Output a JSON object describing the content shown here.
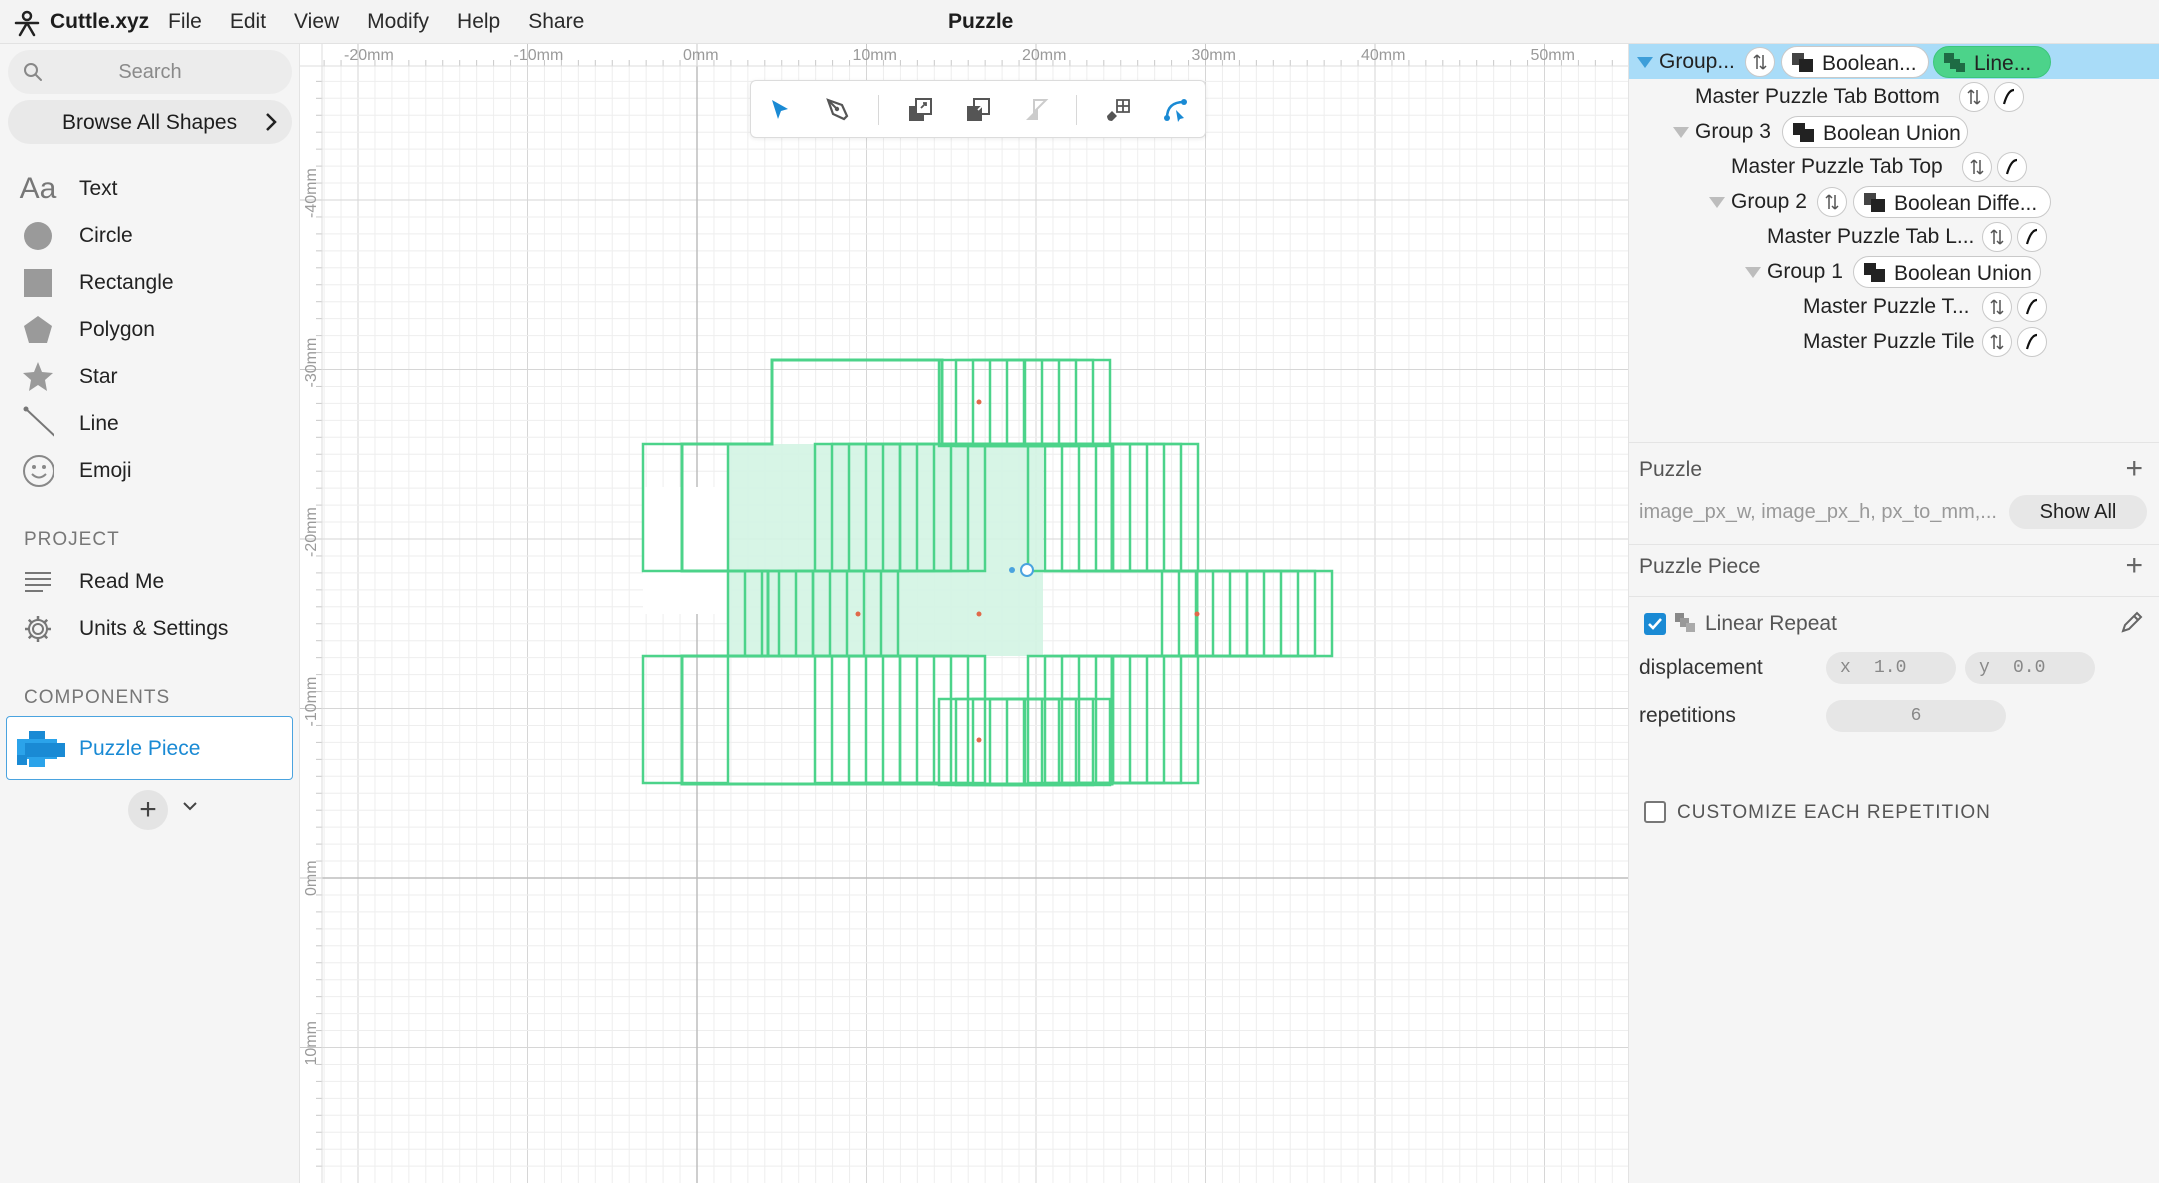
{
  "app": {
    "brand": "Cuttle.xyz",
    "menu": [
      "File",
      "Edit",
      "View",
      "Modify",
      "Help",
      "Share"
    ],
    "document_title": "Puzzle"
  },
  "sidebar": {
    "search_placeholder": "Search",
    "browse_label": "Browse All Shapes",
    "shapes": [
      {
        "label": "Text",
        "icon": "text-icon"
      },
      {
        "label": "Circle",
        "icon": "circle-icon"
      },
      {
        "label": "Rectangle",
        "icon": "rectangle-icon"
      },
      {
        "label": "Polygon",
        "icon": "polygon-icon"
      },
      {
        "label": "Star",
        "icon": "star-icon"
      },
      {
        "label": "Line",
        "icon": "line-icon"
      },
      {
        "label": "Emoji",
        "icon": "emoji-icon"
      }
    ],
    "project_title": "PROJECT",
    "project_items": [
      {
        "label": "Read Me",
        "icon": "document-icon"
      },
      {
        "label": "Units & Settings",
        "icon": "gear-icon"
      }
    ],
    "components_title": "COMPONENTS",
    "component": "Puzzle Piece",
    "add_label": "+"
  },
  "canvas": {
    "ruler_x": [
      "-20mm",
      "-10mm",
      "0mm",
      "10mm",
      "20mm",
      "30mm",
      "40mm",
      "50mm"
    ],
    "ruler_y": [
      "-40mm",
      "-30mm",
      "-20mm",
      "-10mm",
      "0mm",
      "10mm"
    ],
    "shape_color": "#4cd38a",
    "shape_fill": "#d3f4e3",
    "tools": [
      "select-arrow-icon",
      "pen-icon",
      "bring-forward-icon",
      "send-backward-icon",
      "flip-icon",
      "snap-icon",
      "anchor-edit-icon"
    ]
  },
  "tree": {
    "rows": [
      {
        "label": "Group...",
        "modifier": "Boolean...",
        "modifier2": "Line..."
      },
      {
        "label": "Master Puzzle Tab Bottom"
      },
      {
        "label": "Group 3",
        "modifier": "Boolean Union"
      },
      {
        "label": "Master Puzzle Tab Top"
      },
      {
        "label": "Group 2",
        "modifier": "Boolean Diffe..."
      },
      {
        "label": "Master Puzzle Tab L..."
      },
      {
        "label": "Group 1",
        "modifier": "Boolean Union"
      },
      {
        "label": "Master Puzzle T..."
      },
      {
        "label": "Master Puzzle Tile"
      }
    ]
  },
  "params": {
    "puzzle_title": "Puzzle",
    "puzzle_params": "image_px_w, image_px_h, px_to_mm,...",
    "show_all": "Show All",
    "piece_title": "Puzzle Piece",
    "modifier_name": "Linear Repeat",
    "displacement_label": "displacement",
    "displacement_x_axis": "x",
    "displacement_x": "1.0",
    "displacement_y_axis": "y",
    "displacement_y": "0.0",
    "repetitions_label": "repetitions",
    "repetitions": "6",
    "customize": "CUSTOMIZE EACH REPETITION",
    "add": "+"
  }
}
